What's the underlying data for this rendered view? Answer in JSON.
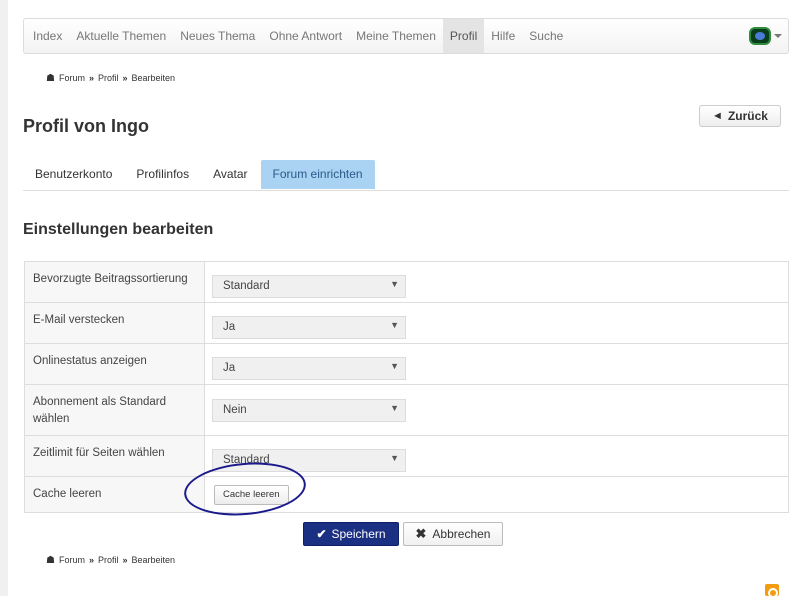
{
  "nav": {
    "items": [
      {
        "label": "Index"
      },
      {
        "label": "Aktuelle Themen"
      },
      {
        "label": "Neues Thema"
      },
      {
        "label": "Ohne Antwort"
      },
      {
        "label": "Meine Themen"
      },
      {
        "label": "Profil",
        "active": true
      },
      {
        "label": "Hilfe"
      },
      {
        "label": "Suche"
      }
    ],
    "user_icon": "user-avatar-icon"
  },
  "breadcrumb": {
    "items": [
      "Forum",
      "Profil",
      "Bearbeiten"
    ]
  },
  "back_button": {
    "label": "Zurück"
  },
  "page_title": "Profil von Ingo",
  "tabs": [
    {
      "label": "Benutzerkonto"
    },
    {
      "label": "Profilinfos"
    },
    {
      "label": "Avatar"
    },
    {
      "label": "Forum einrichten",
      "active": true
    }
  ],
  "section_title": "Einstellungen bearbeiten",
  "settings": {
    "rows": [
      {
        "label": "Bevorzugte Beitragssortierung",
        "value": "Standard"
      },
      {
        "label": "E-Mail verstecken",
        "value": "Ja"
      },
      {
        "label": "Onlinestatus anzeigen",
        "value": "Ja"
      },
      {
        "label": "Abonnement als Standard wählen",
        "value": "Nein"
      },
      {
        "label": "Zeitlimit für Seiten wählen",
        "value": "Standard"
      },
      {
        "label": "Cache leeren",
        "button": "Cache leeren"
      }
    ]
  },
  "actions": {
    "save_label": "Speichern",
    "cancel_label": "Abbrechen"
  },
  "colors": {
    "active_tab": "#a9d2f3",
    "save_button": "#1b2f83",
    "annotation": "#1a1a8c",
    "rss": "#f39c12"
  }
}
